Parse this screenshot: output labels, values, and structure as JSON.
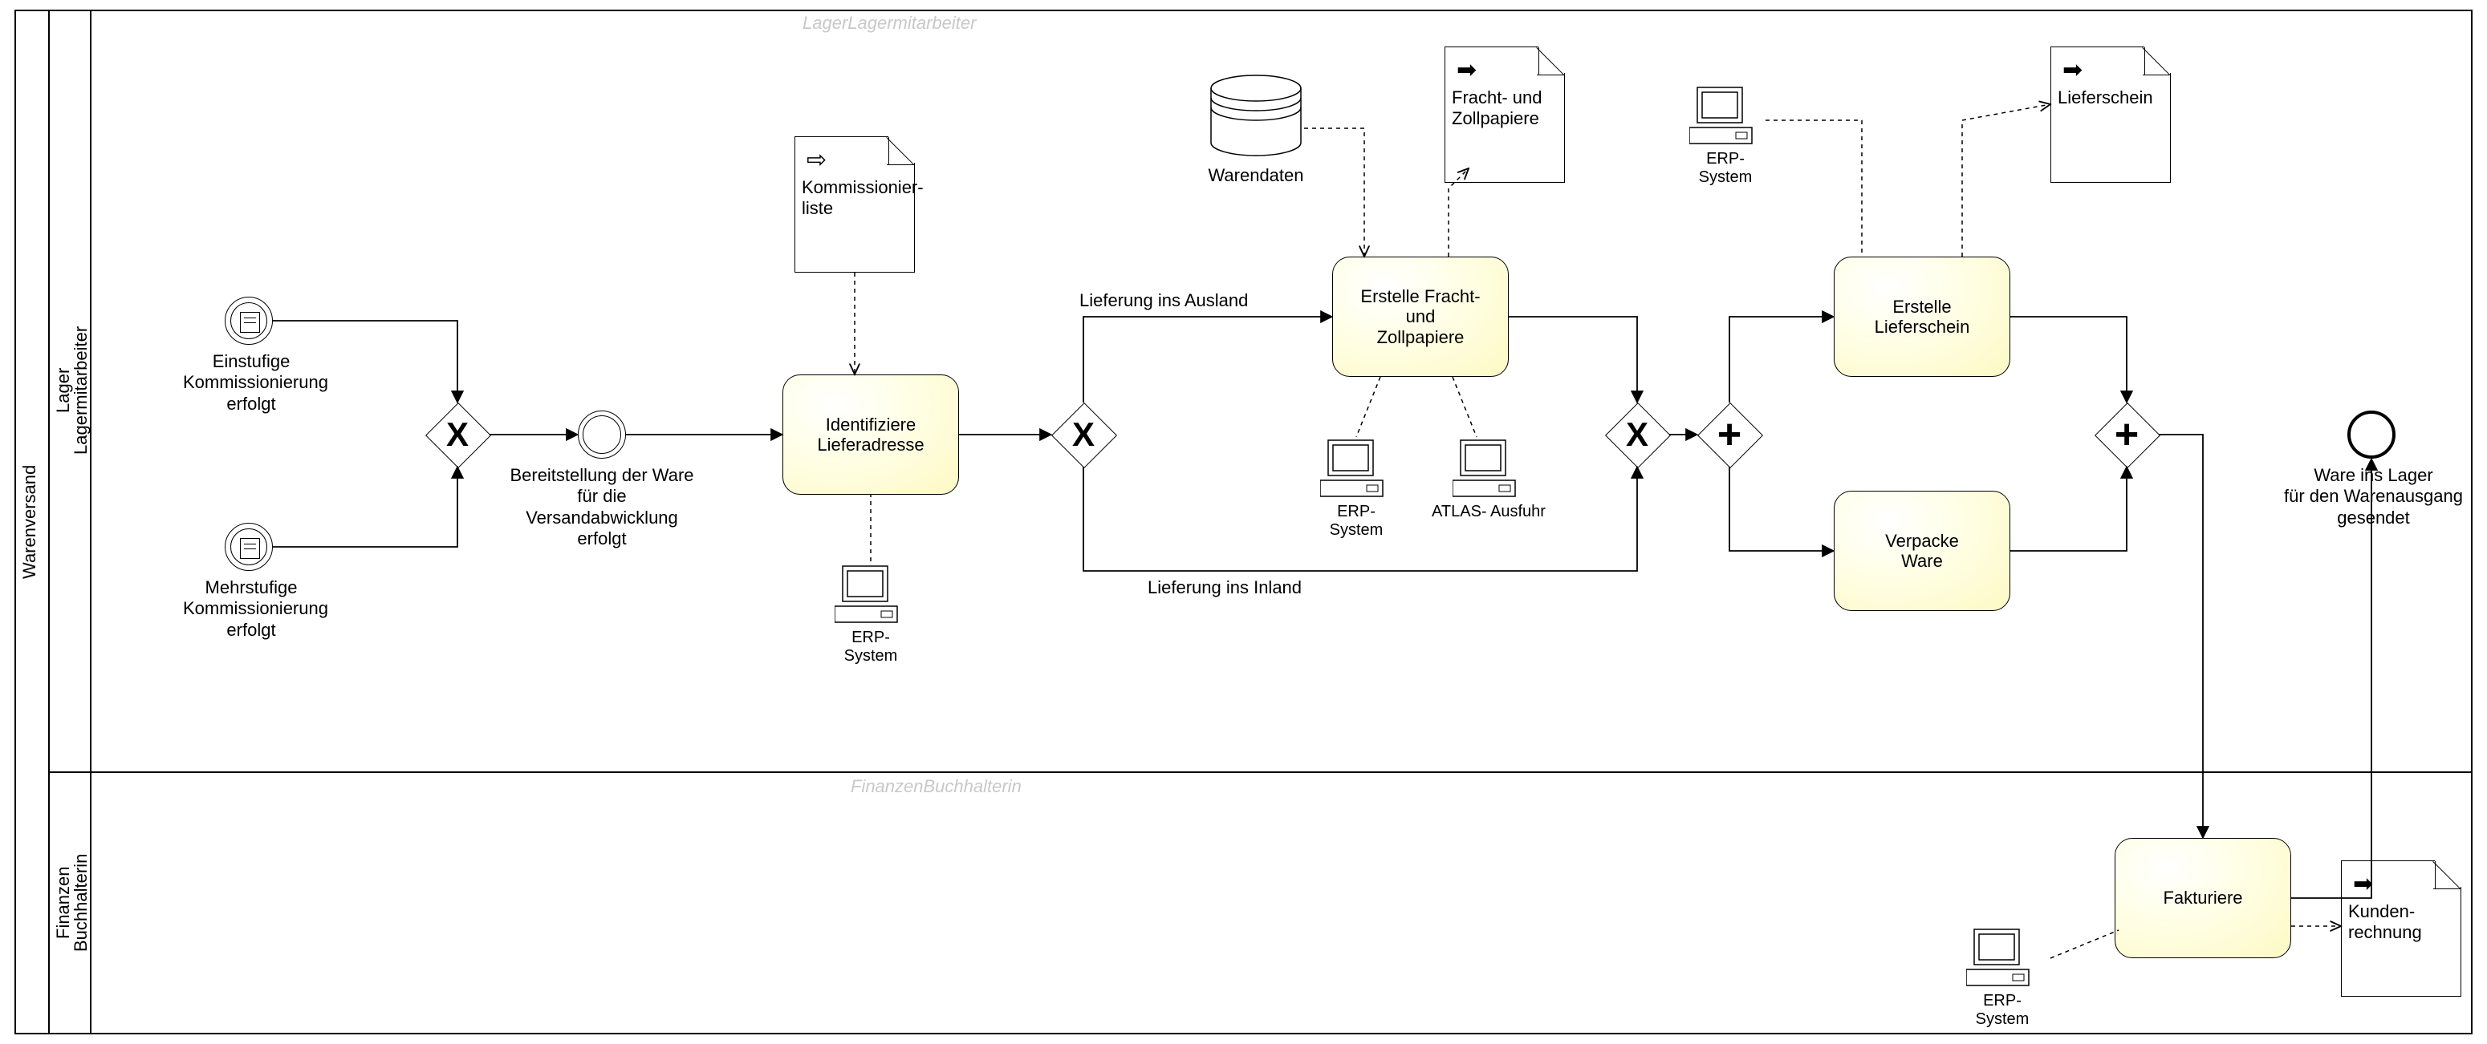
{
  "pool": {
    "name": "Warenversand"
  },
  "lanes": {
    "top": {
      "group": "Lager",
      "role": "Lagermitarbeiter",
      "watermark": "LagerLagermitarbeiter"
    },
    "bottom": {
      "group": "Finanzen",
      "role": "Buchhalterin",
      "watermark": "FinanzenBuchhalterin"
    }
  },
  "events": {
    "start1": "Einstufige\nKommissionierung\nerfolgt",
    "start2": "Mehrstufige\nKommissionierung\nerfolgt",
    "intermediate": "Bereitstellung der Ware\nfür die Versandabwicklung\nerfolgt",
    "end": "Ware ins Lager\nfür den Warenausgang\ngesendet"
  },
  "tasks": {
    "identify": "Identifiziere\nLieferadresse",
    "freight": "Erstelle Fracht-\nund\nZollpapiere",
    "delivery_note": "Erstelle\nLieferschein",
    "pack": "Verpacke\nWare",
    "invoice": "Fakturiere"
  },
  "data": {
    "kommissionierliste": "Kommissionier-\nliste",
    "warendaten": "Warendaten",
    "fracht_zoll": "Fracht- und\nZollpapiere",
    "lieferschein": "Lieferschein",
    "kundenrechnung": "Kunden-\nrechnung"
  },
  "systems": {
    "erp": "ERP- System",
    "atlas": "ATLAS- Ausfuhr"
  },
  "flowlabels": {
    "ausland": "Lieferung ins Ausland",
    "inland": "Lieferung ins Inland"
  }
}
